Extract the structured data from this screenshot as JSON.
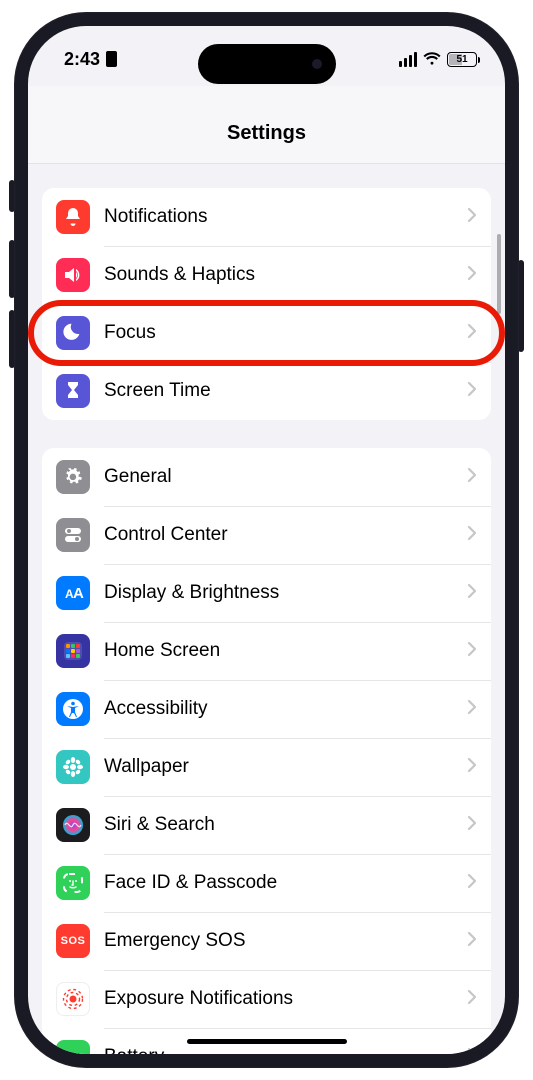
{
  "status_bar": {
    "time": "2:43",
    "battery_level": "51"
  },
  "header": {
    "title": "Settings"
  },
  "groups": [
    {
      "rows": [
        {
          "id": "notifications",
          "label": "Notifications",
          "icon": "bell-icon",
          "color": "#ff3b30"
        },
        {
          "id": "sounds",
          "label": "Sounds & Haptics",
          "icon": "speaker-icon",
          "color": "#ff2d55"
        },
        {
          "id": "focus",
          "label": "Focus",
          "icon": "moon-icon",
          "color": "#5856d6",
          "highlighted": true
        },
        {
          "id": "screentime",
          "label": "Screen Time",
          "icon": "hourglass-icon",
          "color": "#5856d6"
        }
      ]
    },
    {
      "rows": [
        {
          "id": "general",
          "label": "General",
          "icon": "gear-icon",
          "color": "#8e8e93"
        },
        {
          "id": "controlcenter",
          "label": "Control Center",
          "icon": "switches-icon",
          "color": "#8e8e93"
        },
        {
          "id": "display",
          "label": "Display & Brightness",
          "icon": "text-size-icon",
          "color": "#007aff"
        },
        {
          "id": "homescreen",
          "label": "Home Screen",
          "icon": "grid-icon",
          "color": "#3634a3"
        },
        {
          "id": "accessibility",
          "label": "Accessibility",
          "icon": "accessibility-icon",
          "color": "#007aff"
        },
        {
          "id": "wallpaper",
          "label": "Wallpaper",
          "icon": "flower-icon",
          "color": "#34c7c1"
        },
        {
          "id": "siri",
          "label": "Siri & Search",
          "icon": "siri-icon",
          "color": "#1c1c1e"
        },
        {
          "id": "faceid",
          "label": "Face ID & Passcode",
          "icon": "faceid-icon",
          "color": "#30d158"
        },
        {
          "id": "sos",
          "label": "Emergency SOS",
          "icon": "sos-icon",
          "color": "#ff3b30",
          "iconText": "SOS"
        },
        {
          "id": "exposure",
          "label": "Exposure Notifications",
          "icon": "exposure-icon",
          "color": "#ffffff",
          "iconStroke": "#ff3b30"
        },
        {
          "id": "battery",
          "label": "Battery",
          "icon": "battery-icon",
          "color": "#30d158"
        }
      ]
    }
  ]
}
